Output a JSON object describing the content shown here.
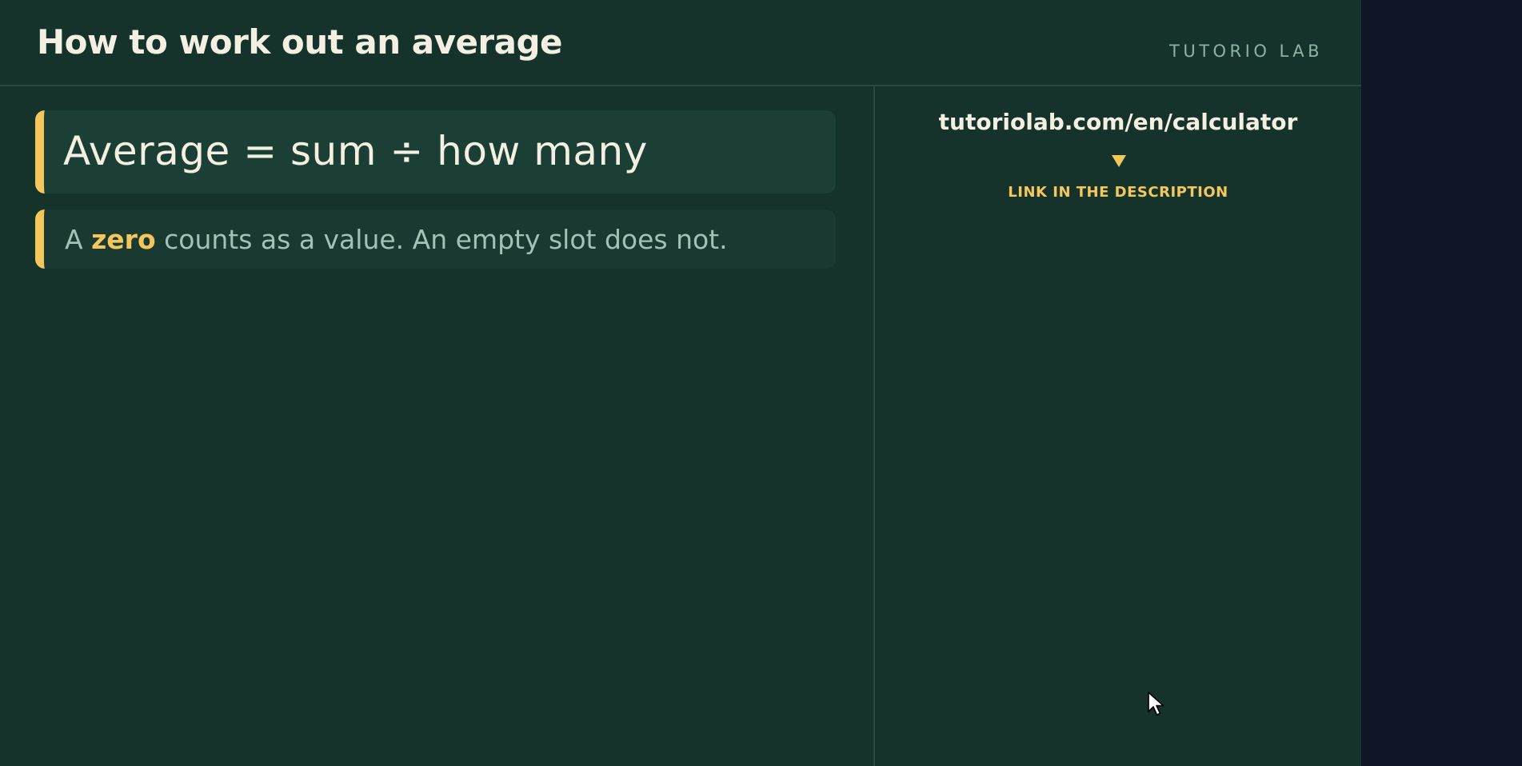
{
  "header": {
    "title": "How to work out an average",
    "brand": "TUTORIO LAB"
  },
  "formula": {
    "text": "Average = sum ÷ how many"
  },
  "note": {
    "prefix": "A",
    "highlight": "zero",
    "suffix": "counts as a value. An empty slot does not."
  },
  "link_panel": {
    "url": "tutoriolab.com/en/calculator",
    "arrow_icon": "down-triangle-icon",
    "caption": "LINK IN THE DESCRIPTION"
  },
  "colors": {
    "board": "#15332b",
    "accent": "#f3c75c",
    "text": "#f3efe3",
    "muted": "#a2c2b5",
    "outside": "#111627"
  },
  "cursor_icon": "mouse-pointer-icon"
}
